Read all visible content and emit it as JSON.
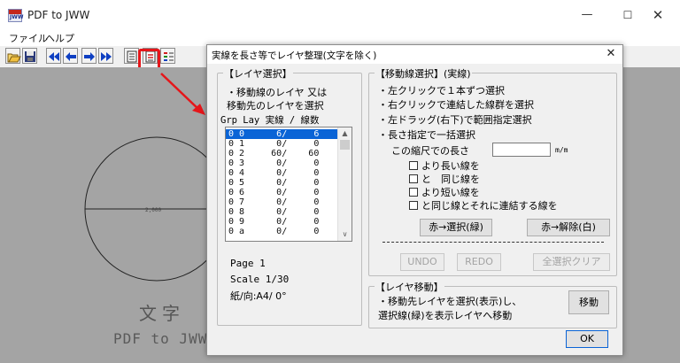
{
  "app": {
    "title": "PDF to JWW",
    "icon_text": "PDF\nJWW",
    "controls": {
      "minimize": "—",
      "maximize": "☐",
      "close": "✕"
    }
  },
  "menu": {
    "file": "ファイル",
    "help": "ヘルプ"
  },
  "toolbar": {
    "icons": [
      "open-folder-icon",
      "save-disk-icon",
      "first-page-icon",
      "prev-page-icon",
      "next-page-icon",
      "last-page-icon",
      "page-list-icon",
      "layer-sort-icon",
      "layer-color-icon"
    ],
    "highlight_color": "#e5161a"
  },
  "canvas": {
    "big_text": "文字",
    "sub_text": "PDF to JWW",
    "circle_dimension": "2,000",
    "background": "#a4a4a4"
  },
  "dialog": {
    "title": "実線を長さ等でレイヤ整理(文字を除く)",
    "close": "✕",
    "layer_select": {
      "title": "【レイヤ選択】",
      "desc1": "・移動線のレイヤ 又は",
      "desc2": "  移動先のレイヤを選択",
      "header": "Grp Lay  実線 / 線数",
      "rows": [
        "0 0      6/     6",
        "0 1      0/     0",
        "0 2     60/    60",
        "0 3      0/     0",
        "0 4      0/     0",
        "0 5      0/     0",
        "0 6      0/     0",
        "0 7      0/     0",
        "0 8      0/     0",
        "0 9      0/     0",
        "0 a      0/     0"
      ],
      "selected_row": 0,
      "scroll_up": "▲",
      "scroll_down": "∨",
      "page_label": "Page     1",
      "scale_label": "Scale  1/30",
      "paper_label": "紙/向:A4/  0°"
    },
    "line_select": {
      "title": "【移動線選択】(実線)",
      "item1": "・左クリックで１本ずつ選択",
      "item2": "・右クリックで連結した線群を選択",
      "item3": "・左ドラッグ(右下)で範囲指定選択",
      "item4": "・長さ指定で一括選択",
      "length_label": "この縮尺での長さ",
      "length_value": "",
      "unit": "m/m",
      "cb_longer": "より長い線を",
      "cb_equal": "と　同じ線を",
      "cb_shorter": "より短い線を",
      "cb_connected": "と同じ線とそれに連結する線を",
      "btn_select_red": "赤→選択(緑)",
      "btn_release_red": "赤→解除(白)",
      "btn_undo": "UNDO",
      "btn_redo": "REDO",
      "btn_clear_all": "全選択クリア"
    },
    "layer_move": {
      "title": "【レイヤ移動】",
      "desc1": "・移動先レイヤを選択(表示)し、",
      "desc2": "  選択線(緑)を表示レイヤへ移動",
      "btn_move": "移動"
    },
    "ok": "OK"
  }
}
